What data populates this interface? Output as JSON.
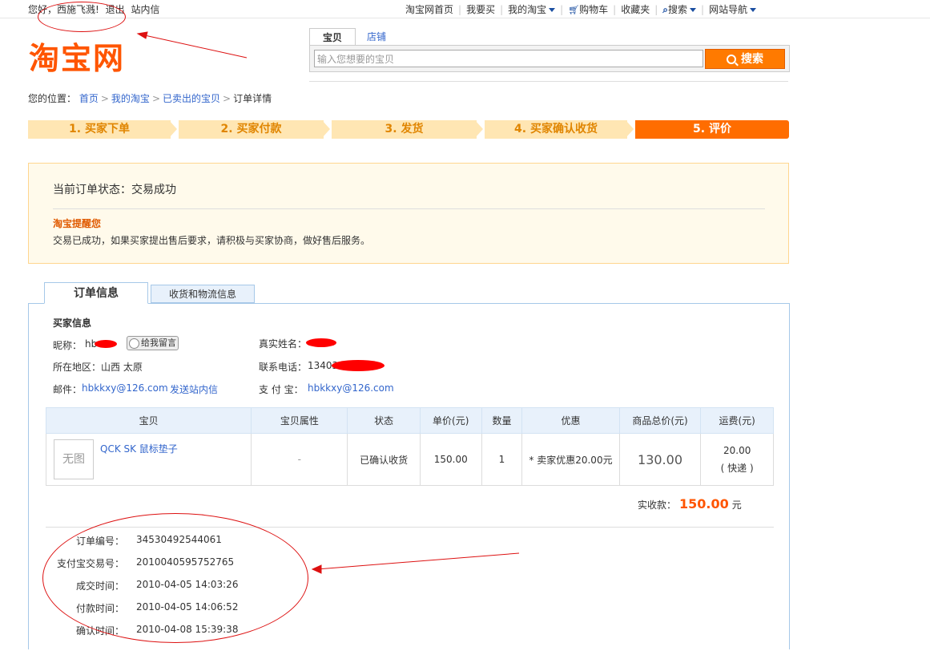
{
  "topbar": {
    "greeting": "您好，",
    "username": "西施飞溅!",
    "logout": "退出",
    "messages": "站内信",
    "nav": [
      "淘宝网首页",
      "我要买",
      "我的淘宝",
      "购物车",
      "收藏夹",
      "搜索",
      "网站导航"
    ]
  },
  "logo": "淘宝网",
  "search": {
    "tab_active": "宝贝",
    "tab_inactive": "店铺",
    "placeholder": "输入您想要的宝贝",
    "button": "搜索"
  },
  "breadcrumb": {
    "prefix": "您的位置：",
    "links": [
      "首页",
      "我的淘宝",
      "已卖出的宝贝"
    ],
    "current": "订单详情"
  },
  "steps": [
    "1. 买家下单",
    "2. 买家付款",
    "3. 发货",
    "4. 买家确认收货",
    "5. 评价"
  ],
  "status": {
    "label": "当前订单状态：交易成功",
    "reminder_title": "淘宝提醒您",
    "reminder_text": "交易已成功，如果买家提出售后要求，请积极与买家协商，做好售后服务。"
  },
  "tabs": {
    "order_info": "订单信息",
    "logistics": "收货和物流信息"
  },
  "buyer": {
    "section_title": "买家信息",
    "nickname_label": "昵称：",
    "nickname_value": "hb",
    "message_button": "给我留言",
    "realname_label": "真实姓名：",
    "region_label": "所在地区：",
    "region_value": "山西 太原",
    "phone_label": "联系电话：",
    "phone_value": "13403",
    "email_label": "邮件：",
    "email_value": "hbkkxy@126.com",
    "send_message": "发送站内信",
    "alipay_label": "支 付 宝：",
    "alipay_value": "hbkkxy@126.com"
  },
  "table": {
    "headers": [
      "宝贝",
      "宝贝属性",
      "状态",
      "单价(元)",
      "数量",
      "优惠",
      "商品总价(元)",
      "运费(元)"
    ],
    "row": {
      "image": "无图",
      "name": "QCK SK 鼠标垫子",
      "attr": "-",
      "status": "已确认收货",
      "price": "150.00",
      "qty": "1",
      "discount": "* 卖家优惠20.00元",
      "total": "130.00",
      "shipping": "20.00",
      "shipping_method": "( 快递 )"
    }
  },
  "total": {
    "label": "实收款：",
    "amount": "150.00",
    "unit": "元"
  },
  "meta": [
    {
      "label": "订单编号：",
      "value": "34530492544061"
    },
    {
      "label": "支付宝交易号：",
      "value": "2010040595752765"
    },
    {
      "label": "成交时间：",
      "value": "2010-04-05 14:03:26"
    },
    {
      "label": "付款时间：",
      "value": "2010-04-05 14:06:52"
    },
    {
      "label": "确认时间：",
      "value": "2010-04-08 15:39:38"
    }
  ],
  "colors": {
    "brand": "#ff5500",
    "link": "#3366cc",
    "step_active": "#ff6d00",
    "step_inactive": "#ffe6b3",
    "annotation": "#dd1111"
  }
}
